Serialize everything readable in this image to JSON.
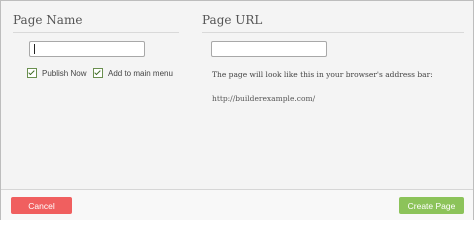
{
  "page_name": {
    "title": "Page Name",
    "input_value": ""
  },
  "options": {
    "publish_now": {
      "label": "Publish Now",
      "checked": true
    },
    "add_to_menu": {
      "label": "Add to main menu",
      "checked": true
    }
  },
  "page_url": {
    "title": "Page URL",
    "input_value": "",
    "hint": "The page will look like this in your browser's address bar:",
    "example": "http://builderexample.com/"
  },
  "footer": {
    "cancel_label": "Cancel",
    "create_label": "Create Page"
  },
  "colors": {
    "cancel": "#f05f5f",
    "create": "#8cc35a"
  }
}
